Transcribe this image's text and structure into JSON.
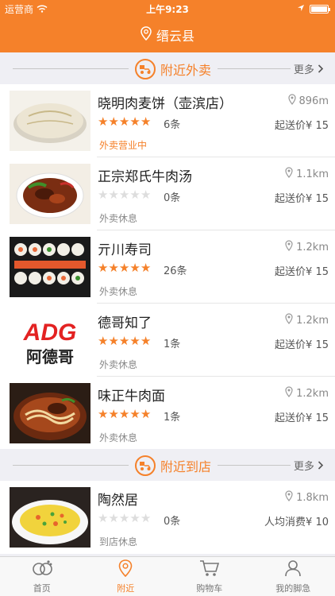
{
  "status_bar": {
    "carrier": "运营商",
    "time": "上午9:23"
  },
  "header": {
    "location": "缙云县"
  },
  "sections": [
    {
      "title": "附近外卖",
      "more": "更多",
      "items": [
        {
          "name": "晓明肉麦饼（壶滨店）",
          "distance": "896m",
          "rating": 5,
          "reviews": "6条",
          "price_label": "起送价¥ 15",
          "status": "外卖营业中",
          "status_open": true
        },
        {
          "name": "正宗郑氏牛肉汤",
          "distance": "1.1km",
          "rating": 0,
          "reviews": "0条",
          "price_label": "起送价¥ 15",
          "status": "外卖休息",
          "status_open": false
        },
        {
          "name": "亓川寿司",
          "distance": "1.2km",
          "rating": 4.5,
          "reviews": "26条",
          "price_label": "起送价¥ 15",
          "status": "外卖休息",
          "status_open": false
        },
        {
          "name": "德哥知了",
          "distance": "1.2km",
          "rating": 5,
          "reviews": "1条",
          "price_label": "起送价¥ 15",
          "status": "外卖休息",
          "status_open": false
        },
        {
          "name": "味正牛肉面",
          "distance": "1.2km",
          "rating": 5,
          "reviews": "1条",
          "price_label": "起送价¥ 15",
          "status": "外卖休息",
          "status_open": false
        }
      ]
    },
    {
      "title": "附近到店",
      "more": "更多",
      "items": [
        {
          "name": "陶然居",
          "distance": "1.8km",
          "rating": 0,
          "reviews": "0条",
          "price_label": "人均消费¥ 10",
          "status": "到店休息",
          "status_open": false
        }
      ]
    }
  ],
  "logo_text": {
    "brand": "ADG",
    "chinese": "阿德哥"
  },
  "tabs": [
    {
      "label": "首页",
      "icon": "home-icon",
      "active": false
    },
    {
      "label": "附近",
      "icon": "location-pin-icon",
      "active": true
    },
    {
      "label": "购物车",
      "icon": "cart-icon",
      "active": false
    },
    {
      "label": "我的脚急",
      "icon": "user-icon",
      "active": false
    }
  ],
  "colors": {
    "accent": "#f5812a",
    "background": "#efeff4"
  }
}
